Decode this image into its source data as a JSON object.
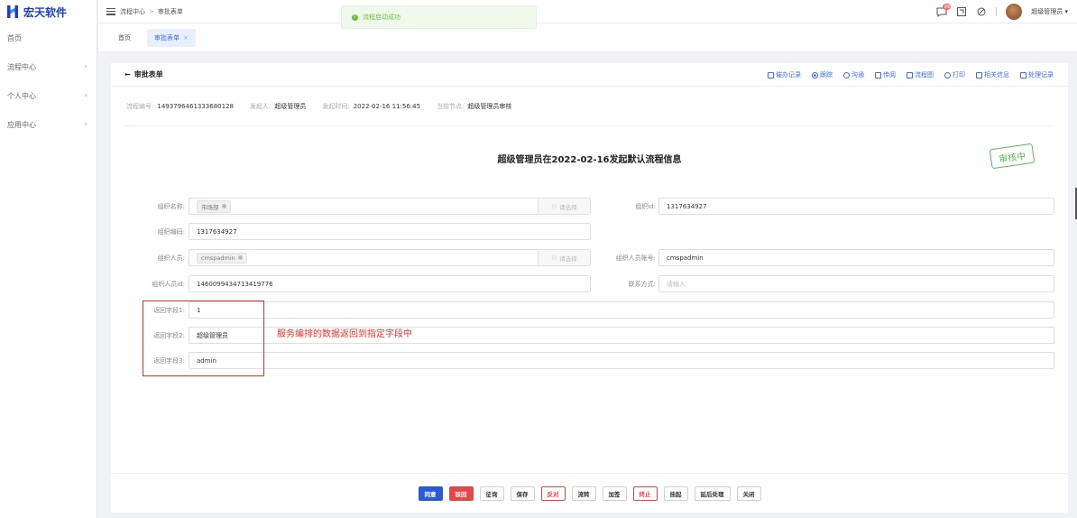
{
  "brand": {
    "name": "宏天软件",
    "color": "#1f3fbf"
  },
  "sidebar": {
    "items": [
      {
        "label": "首页",
        "has_children": false
      },
      {
        "label": "流程中心",
        "has_children": true
      },
      {
        "label": "个人中心",
        "has_children": true
      },
      {
        "label": "应用中心",
        "has_children": true
      }
    ]
  },
  "header": {
    "breadcrumb": [
      "流程中心",
      "审批表单"
    ],
    "breadcrumb_sep": ">",
    "notification_count": "99",
    "username": "超级管理员"
  },
  "toast": {
    "message": "流程启动成功",
    "type": "success"
  },
  "tabs": [
    {
      "label": "首页",
      "active": false
    },
    {
      "label": "审批表单",
      "active": true,
      "closable": "×"
    }
  ],
  "form": {
    "back_label": "审批表单",
    "actions": [
      {
        "label": "催办记录",
        "icon": "list-icon"
      },
      {
        "label": "跟踪",
        "icon": "target-icon"
      },
      {
        "label": "沟通",
        "icon": "chat-icon"
      },
      {
        "label": "传阅",
        "icon": "share-icon"
      },
      {
        "label": "流程图",
        "icon": "flowchart-icon"
      },
      {
        "label": "打印",
        "icon": "print-icon"
      },
      {
        "label": "相关信息",
        "icon": "info-icon"
      },
      {
        "label": "处理记录",
        "icon": "history-icon"
      }
    ],
    "meta": {
      "flow_no_label": "流程编号:",
      "flow_no": "1493796461333680128",
      "initiator_label": "发起人:",
      "initiator": "超级管理员",
      "time_label": "发起时间:",
      "time": "2022-02-16 11:56:45",
      "node_label": "当前节点:",
      "node": "超级管理员审核"
    },
    "title": "超级管理员在2022-02-16发起默认流程信息",
    "stamp": "审核中",
    "fields": {
      "org_name_label": "组织名称:",
      "org_name_tag": "市场部",
      "picker_label": "请选择",
      "org_id_label": "组织id:",
      "org_id": "1317634927",
      "org_code_label": "组织编码:",
      "org_code": "1317634927",
      "org_person_label": "组织人员:",
      "org_person_tag": "cmspadmin",
      "org_person_account_label": "组织人员账号:",
      "org_person_account": "cmspadmin",
      "org_person_id_label": "组织人员id:",
      "org_person_id": "1460099434713419776",
      "contact_label": "联系方式:",
      "contact_placeholder": "请输入",
      "ret1_label": "返回字段1:",
      "ret1": "1",
      "ret2_label": "返回字段2:",
      "ret2": "超级管理员",
      "ret3_label": "返回字段3:",
      "ret3": "admin"
    },
    "annotation": "服务编排的数据返回到指定字段中"
  },
  "buttons": [
    {
      "label": "同意",
      "style": "blue"
    },
    {
      "label": "驳回",
      "style": "red"
    },
    {
      "label": "征询",
      "style": "default"
    },
    {
      "label": "保存",
      "style": "default"
    },
    {
      "label": "反对",
      "style": "redline"
    },
    {
      "label": "流转",
      "style": "default"
    },
    {
      "label": "加签",
      "style": "default"
    },
    {
      "label": "终止",
      "style": "redline"
    },
    {
      "label": "挂起",
      "style": "default"
    },
    {
      "label": "延后处理",
      "style": "default"
    },
    {
      "label": "关闭",
      "style": "default"
    }
  ],
  "colors": {
    "accent": "#3a6cf4",
    "success": "#67c23a",
    "danger": "#e8332a"
  }
}
